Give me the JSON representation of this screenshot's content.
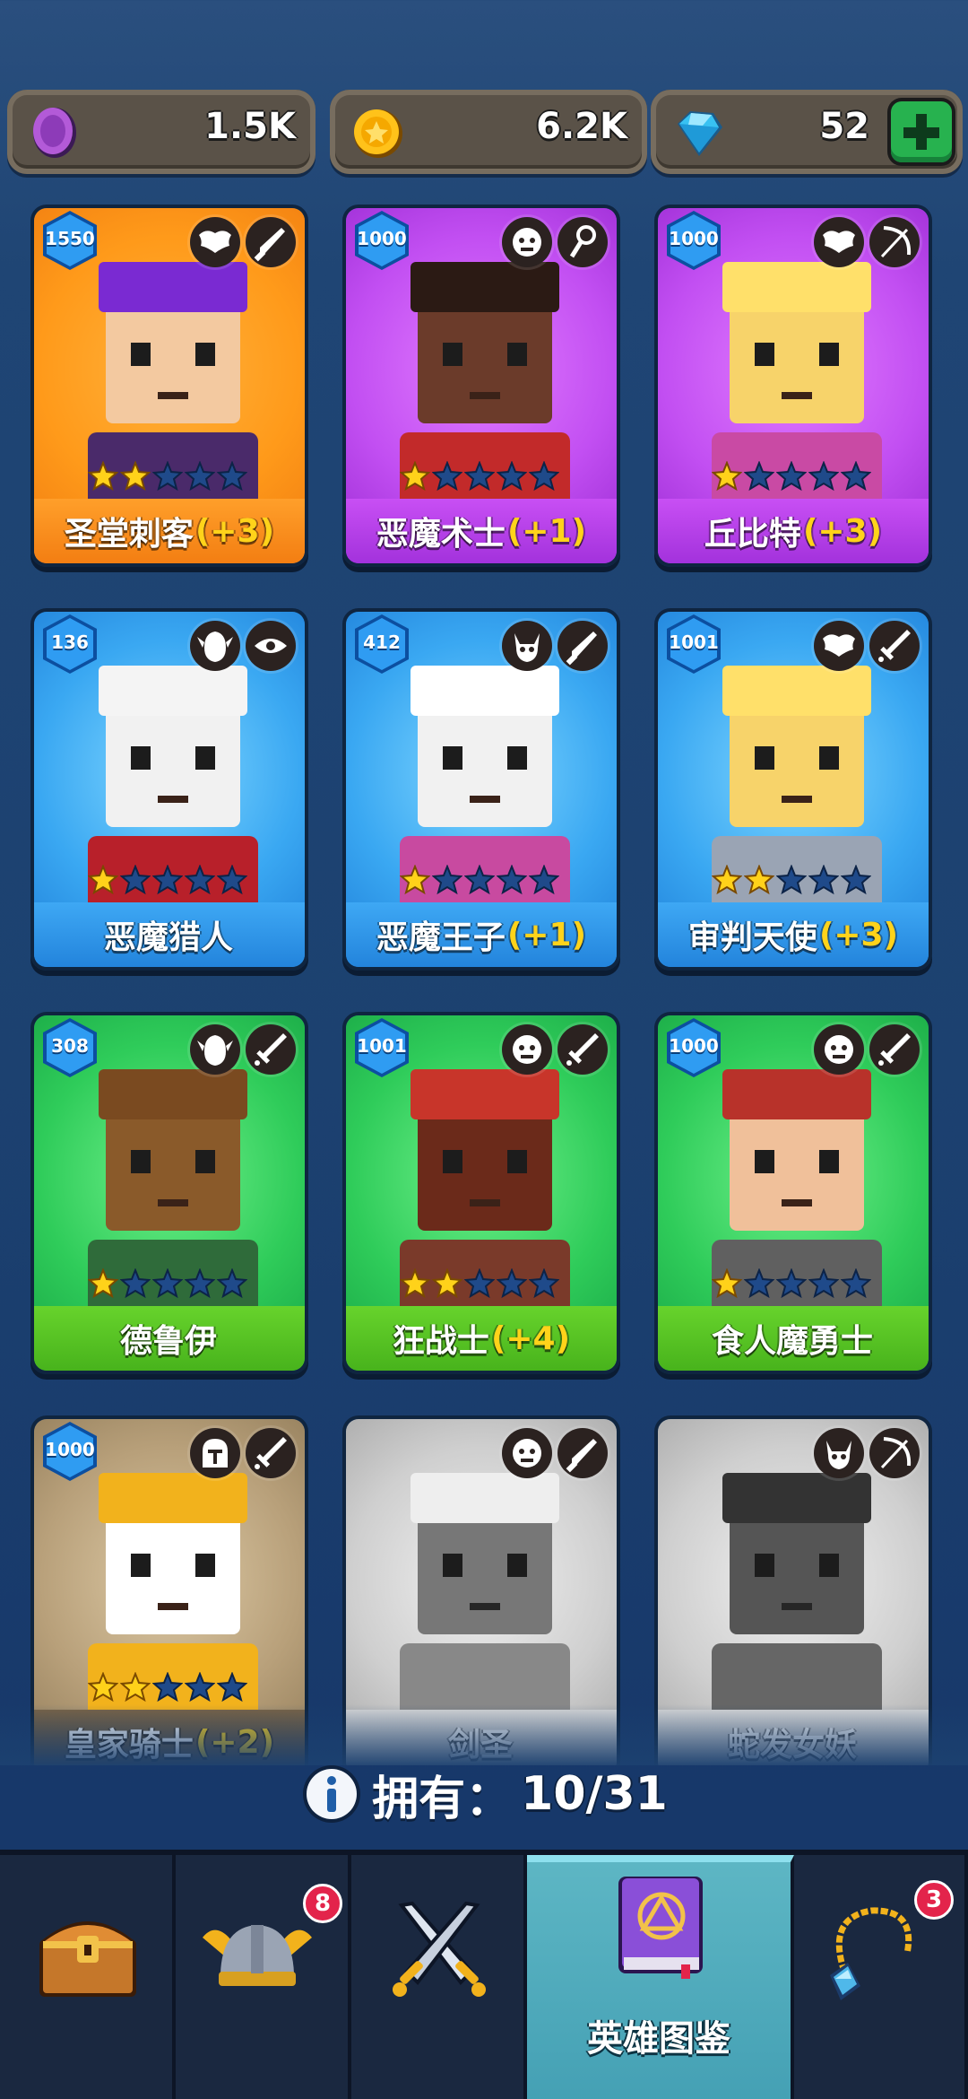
{
  "currency": {
    "purple_coin": "1.5K",
    "gold_coin": "6.2K",
    "gems": "52"
  },
  "heroes": [
    {
      "name": "圣堂刺客",
      "bonus": "(+3)",
      "level": "1550",
      "stars": 2,
      "rarity": "orange",
      "class_icons": [
        "wings-icon",
        "dagger-icon"
      ]
    },
    {
      "name": "恶魔术士",
      "bonus": "(+1)",
      "level": "1000",
      "stars": 1,
      "rarity": "purple",
      "class_icons": [
        "orc-icon",
        "staff-icon"
      ]
    },
    {
      "name": "丘比特",
      "bonus": "(+3)",
      "level": "1000",
      "stars": 1,
      "rarity": "purple",
      "class_icons": [
        "wings-icon",
        "bow-icon"
      ]
    },
    {
      "name": "恶魔猎人",
      "bonus": "",
      "level": "136",
      "stars": 1,
      "rarity": "blue",
      "class_icons": [
        "elf-icon",
        "eye-icon"
      ]
    },
    {
      "name": "恶魔王子",
      "bonus": "(+1)",
      "level": "412",
      "stars": 1,
      "rarity": "blue",
      "class_icons": [
        "demon-icon",
        "dagger-icon"
      ]
    },
    {
      "name": "审判天使",
      "bonus": "(+3)",
      "level": "1001",
      "stars": 2,
      "rarity": "blue",
      "class_icons": [
        "wings-icon",
        "sword-icon"
      ]
    },
    {
      "name": "德鲁伊",
      "bonus": "",
      "level": "308",
      "stars": 1,
      "rarity": "green",
      "class_icons": [
        "elf-icon",
        "sword-icon"
      ]
    },
    {
      "name": "狂战士",
      "bonus": "(+4)",
      "level": "1001",
      "stars": 2,
      "rarity": "green",
      "class_icons": [
        "orc-icon",
        "sword-icon"
      ]
    },
    {
      "name": "食人魔勇士",
      "bonus": "",
      "level": "1000",
      "stars": 1,
      "rarity": "green",
      "class_icons": [
        "orc-icon",
        "sword-icon"
      ]
    },
    {
      "name": "皇家骑士",
      "bonus": "(+2)",
      "level": "1000",
      "stars": 2,
      "rarity": "brown",
      "class_icons": [
        "helmet-icon",
        "sword-icon"
      ]
    },
    {
      "name": "剑圣",
      "bonus": "",
      "level": "",
      "stars": 0,
      "rarity": "gray",
      "class_icons": [
        "orc-icon",
        "dagger-icon"
      ]
    },
    {
      "name": "蛇发女妖",
      "bonus": "",
      "level": "",
      "stars": 0,
      "rarity": "gray",
      "class_icons": [
        "demon-icon",
        "bow-icon"
      ]
    }
  ],
  "owned": {
    "label": "拥有：",
    "count": "10/31"
  },
  "nav": {
    "tabs": [
      {
        "name": "shop",
        "label": "",
        "badge": ""
      },
      {
        "name": "heroes",
        "label": "",
        "badge": "8"
      },
      {
        "name": "battle",
        "label": "",
        "badge": ""
      },
      {
        "name": "codex",
        "label": "英雄图鉴",
        "badge": ""
      },
      {
        "name": "equipment",
        "label": "",
        "badge": "3"
      }
    ]
  },
  "colors": {
    "background": "#1f4574",
    "orange": "#ff9a1a",
    "purple": "#c24ff2",
    "blue": "#3aa8f2",
    "green": "#2fcc5a",
    "brown": "#b8a07a",
    "gray": "#cfcfcf",
    "bonus": "#ffd31a",
    "active_tab": "#5db6c4"
  }
}
